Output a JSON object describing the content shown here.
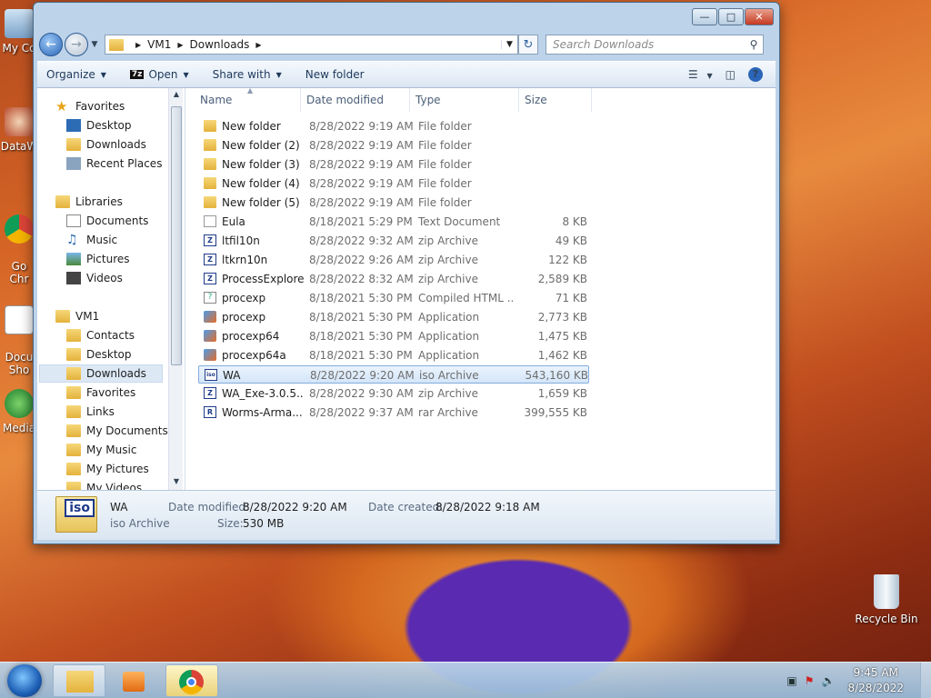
{
  "desktop": {
    "icons": [
      {
        "label": "My Co",
        "icon": "computer-icon"
      },
      {
        "label": "DataW",
        "icon": "shortcut-icon"
      },
      {
        "label": "Go\nChr",
        "icon": "chrome-icon"
      },
      {
        "label": "Docu\nSho",
        "icon": "document-icon"
      },
      {
        "label": "Media",
        "icon": "media-icon"
      },
      {
        "label": "Recycle Bin",
        "icon": "recycle-bin-icon"
      }
    ]
  },
  "window": {
    "address": {
      "crumbs": [
        "VM1",
        "Downloads"
      ]
    },
    "search_placeholder": "Search Downloads",
    "toolbar": {
      "organize": "Organize",
      "open": "Open",
      "open_badge": "7z",
      "share": "Share with",
      "new_folder": "New folder"
    },
    "nav": {
      "favorites": "Favorites",
      "fav_items": [
        "Desktop",
        "Downloads",
        "Recent Places"
      ],
      "libraries": "Libraries",
      "lib_items": [
        "Documents",
        "Music",
        "Pictures",
        "Videos"
      ],
      "vm1": "VM1",
      "vm1_items": [
        "Contacts",
        "Desktop",
        "Downloads",
        "Favorites",
        "Links",
        "My Documents",
        "My Music",
        "My Pictures",
        "My Videos"
      ],
      "selected": "Downloads"
    },
    "columns": [
      "Name",
      "Date modified",
      "Type",
      "Size"
    ],
    "files": [
      {
        "name": "New folder",
        "date": "8/28/2022 9:19 AM",
        "type": "File folder",
        "size": "",
        "icon": "folder-icon"
      },
      {
        "name": "New folder (2)",
        "date": "8/28/2022 9:19 AM",
        "type": "File folder",
        "size": "",
        "icon": "folder-icon"
      },
      {
        "name": "New folder (3)",
        "date": "8/28/2022 9:19 AM",
        "type": "File folder",
        "size": "",
        "icon": "folder-icon"
      },
      {
        "name": "New folder (4)",
        "date": "8/28/2022 9:19 AM",
        "type": "File folder",
        "size": "",
        "icon": "folder-icon"
      },
      {
        "name": "New folder (5)",
        "date": "8/28/2022 9:19 AM",
        "type": "File folder",
        "size": "",
        "icon": "folder-icon"
      },
      {
        "name": "Eula",
        "date": "8/18/2021 5:29 PM",
        "type": "Text Document",
        "size": "8 KB",
        "icon": "text-icon"
      },
      {
        "name": "ltfil10n",
        "date": "8/28/2022 9:32 AM",
        "type": "zip Archive",
        "size": "49 KB",
        "icon": "zip-icon"
      },
      {
        "name": "ltkrn10n",
        "date": "8/28/2022 9:26 AM",
        "type": "zip Archive",
        "size": "122 KB",
        "icon": "zip-icon"
      },
      {
        "name": "ProcessExplorer",
        "date": "8/28/2022 8:32 AM",
        "type": "zip Archive",
        "size": "2,589 KB",
        "icon": "zip-icon"
      },
      {
        "name": "procexp",
        "date": "8/18/2021 5:30 PM",
        "type": "Compiled HTML ...",
        "size": "71 KB",
        "icon": "chm-icon"
      },
      {
        "name": "procexp",
        "date": "8/18/2021 5:30 PM",
        "type": "Application",
        "size": "2,773 KB",
        "icon": "app-icon"
      },
      {
        "name": "procexp64",
        "date": "8/18/2021 5:30 PM",
        "type": "Application",
        "size": "1,475 KB",
        "icon": "app-icon"
      },
      {
        "name": "procexp64a",
        "date": "8/18/2021 5:30 PM",
        "type": "Application",
        "size": "1,462 KB",
        "icon": "app-icon"
      },
      {
        "name": "WA",
        "date": "8/28/2022 9:20 AM",
        "type": "iso Archive",
        "size": "543,160 KB",
        "icon": "iso-icon"
      },
      {
        "name": "WA_Exe-3.0.5....",
        "date": "8/28/2022 9:30 AM",
        "type": "zip Archive",
        "size": "1,659 KB",
        "icon": "zip-icon"
      },
      {
        "name": "Worms-Arma...",
        "date": "8/28/2022 9:37 AM",
        "type": "rar Archive",
        "size": "399,555 KB",
        "icon": "rar-icon"
      }
    ],
    "selected_index": 13,
    "details": {
      "name": "WA",
      "type": "iso Archive",
      "badge": "iso",
      "modified_label": "Date modified:",
      "modified": "8/28/2022 9:20 AM",
      "created_label": "Date created:",
      "created": "8/28/2022 9:18 AM",
      "size_label": "Size:",
      "size": "530 MB"
    }
  },
  "taskbar": {
    "time": "9:45 AM",
    "date": "8/28/2022"
  }
}
